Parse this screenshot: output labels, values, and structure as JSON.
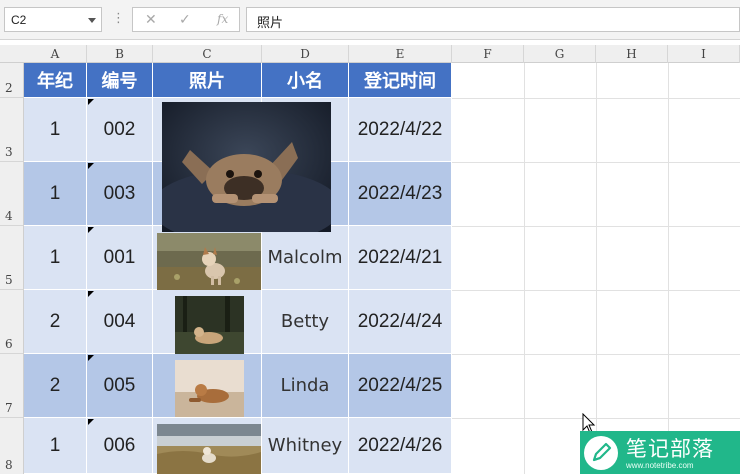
{
  "formula_bar": {
    "name_box": "C2",
    "formula": "照片",
    "buttons": {
      "cancel": "✕",
      "enter": "✓",
      "fx": "fx"
    }
  },
  "columns": [
    "A",
    "B",
    "C",
    "D",
    "E",
    "F",
    "G",
    "H",
    "I"
  ],
  "rows": [
    "2",
    "3",
    "4",
    "5",
    "6",
    "7",
    "8"
  ],
  "table": {
    "headers": {
      "grade": "年纪",
      "number": "编号",
      "photo": "照片",
      "name": "小名",
      "date": "登记时间"
    },
    "records": [
      {
        "grade": "1",
        "number": "002",
        "name": "",
        "date": "2022/4/22"
      },
      {
        "grade": "1",
        "number": "003",
        "name": "",
        "date": "2022/4/23"
      },
      {
        "grade": "1",
        "number": "001",
        "name": "Malcolm",
        "date": "2022/4/21"
      },
      {
        "grade": "2",
        "number": "004",
        "name": "Betty",
        "date": "2022/4/24"
      },
      {
        "grade": "2",
        "number": "005",
        "name": "Linda",
        "date": "2022/4/25"
      },
      {
        "grade": "1",
        "number": "006",
        "name": "Whitney",
        "date": "2022/4/26"
      }
    ]
  },
  "watermark": {
    "title": "笔记部落",
    "url": "www.notetribe.com"
  },
  "colors": {
    "header_blue": "#4472c4",
    "band_light": "#dae3f3",
    "band_dark": "#b4c7e7",
    "watermark_green": "#21b78a"
  }
}
